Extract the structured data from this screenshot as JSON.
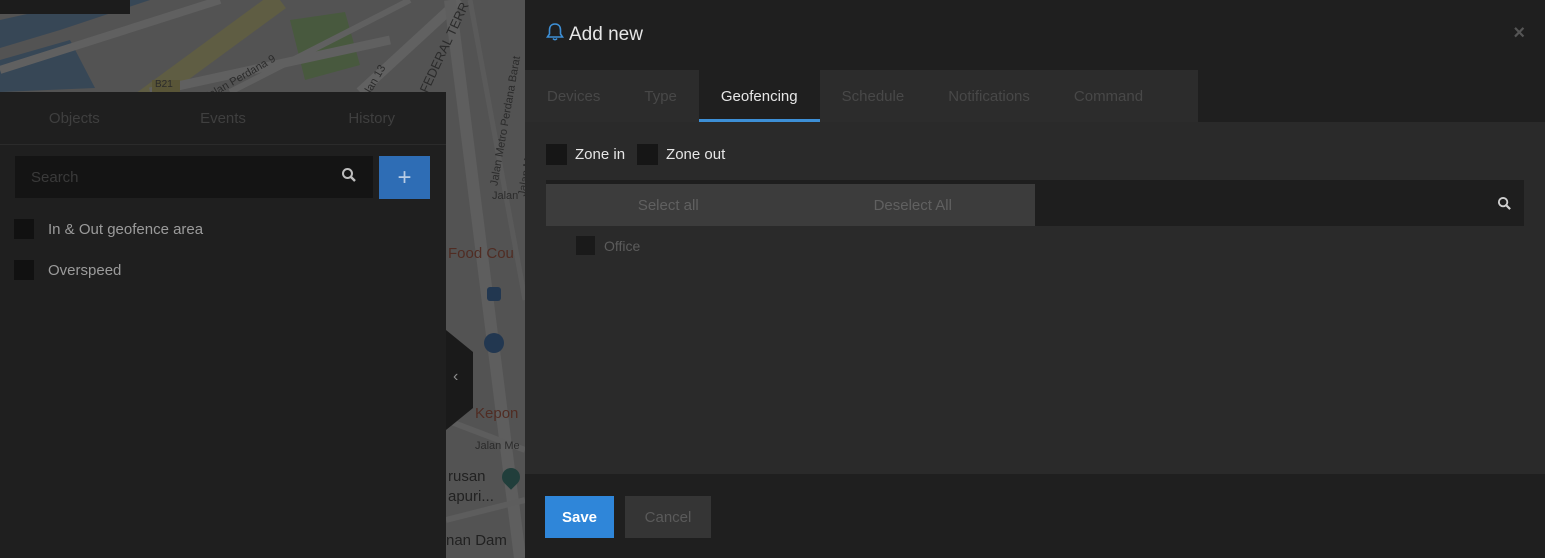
{
  "map": {
    "road_badge": "B21",
    "street_labels": [
      "Jalan Perdana 9",
      "Jalan 13",
      "FEDERAL TERR",
      "Jalan Metro Perdana Barat",
      "Jalan Metro Perdana",
      "Jalan"
    ],
    "poi_labels": [
      "Food Cou",
      "Kepon",
      "Jalan Me",
      "rusan",
      "apuri...",
      "nan Dam"
    ]
  },
  "left_panel": {
    "tabs": [
      "Objects",
      "Events",
      "History"
    ],
    "search_placeholder": "Search",
    "add_button": "+",
    "items": [
      {
        "label": "In & Out geofence area"
      },
      {
        "label": "Overspeed"
      }
    ],
    "collapse_icon": "‹"
  },
  "dialog": {
    "title": "Add new",
    "title_icon": "bell-icon",
    "close": "×",
    "tabs": [
      {
        "label": "Devices",
        "active": false
      },
      {
        "label": "Type",
        "active": false
      },
      {
        "label": "Geofencing",
        "active": true
      },
      {
        "label": "Schedule",
        "active": false
      },
      {
        "label": "Notifications",
        "active": false
      },
      {
        "label": "Command",
        "active": false
      }
    ],
    "zone_in": "Zone in",
    "zone_out": "Zone out",
    "select_all": "Select all",
    "deselect_all": "Deselect All",
    "geofences": [
      {
        "label": "Office"
      }
    ],
    "save": "Save",
    "cancel": "Cancel"
  },
  "colors": {
    "accent": "#2f86d9",
    "tab_underline": "#3d8fd6",
    "add_button": "#2e6db5"
  }
}
